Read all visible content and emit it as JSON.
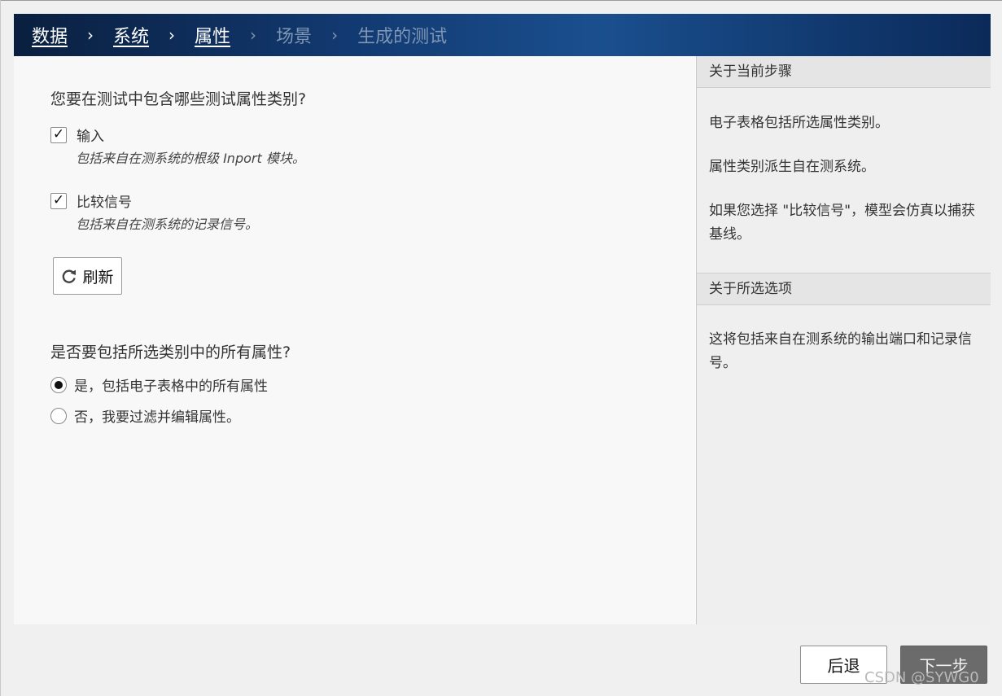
{
  "breadcrumb": {
    "steps": [
      {
        "label": "数据",
        "state": "done"
      },
      {
        "label": "系统",
        "state": "done"
      },
      {
        "label": "属性",
        "state": "done"
      },
      {
        "label": "场景",
        "state": "todo"
      },
      {
        "label": "生成的测试",
        "state": "todo"
      }
    ],
    "separator": "›"
  },
  "main": {
    "question1": "您要在测试中包含哪些测试属性类别?",
    "options": [
      {
        "label": "输入",
        "checked": true,
        "description": "包括来自在测系统的根级 Inport 模块。"
      },
      {
        "label": "比较信号",
        "checked": true,
        "description": "包括来自在测系统的记录信号。"
      }
    ],
    "check_glyph": "✓",
    "refresh_label": "刷新",
    "refresh_icon": "refresh-icon",
    "question2": "是否要包括所选类别中的所有属性?",
    "radios": [
      {
        "label": "是，包括电子表格中的所有属性",
        "selected": true
      },
      {
        "label": "否，我要过滤并编辑属性。",
        "selected": false
      }
    ]
  },
  "side": {
    "section1_title": "关于当前步骤",
    "section1_paragraphs": [
      "电子表格包括所选属性类别。",
      "属性类别派生自在测系统。",
      "如果您选择 \"比较信号\"，模型会仿真以捕获基线。"
    ],
    "section2_title": "关于所选选项",
    "section2_text": "这将包括来自在测系统的输出端口和记录信号。"
  },
  "footer": {
    "back_label": "后退",
    "next_label": "下一步"
  },
  "watermark": "CSDN @SYWG0"
}
